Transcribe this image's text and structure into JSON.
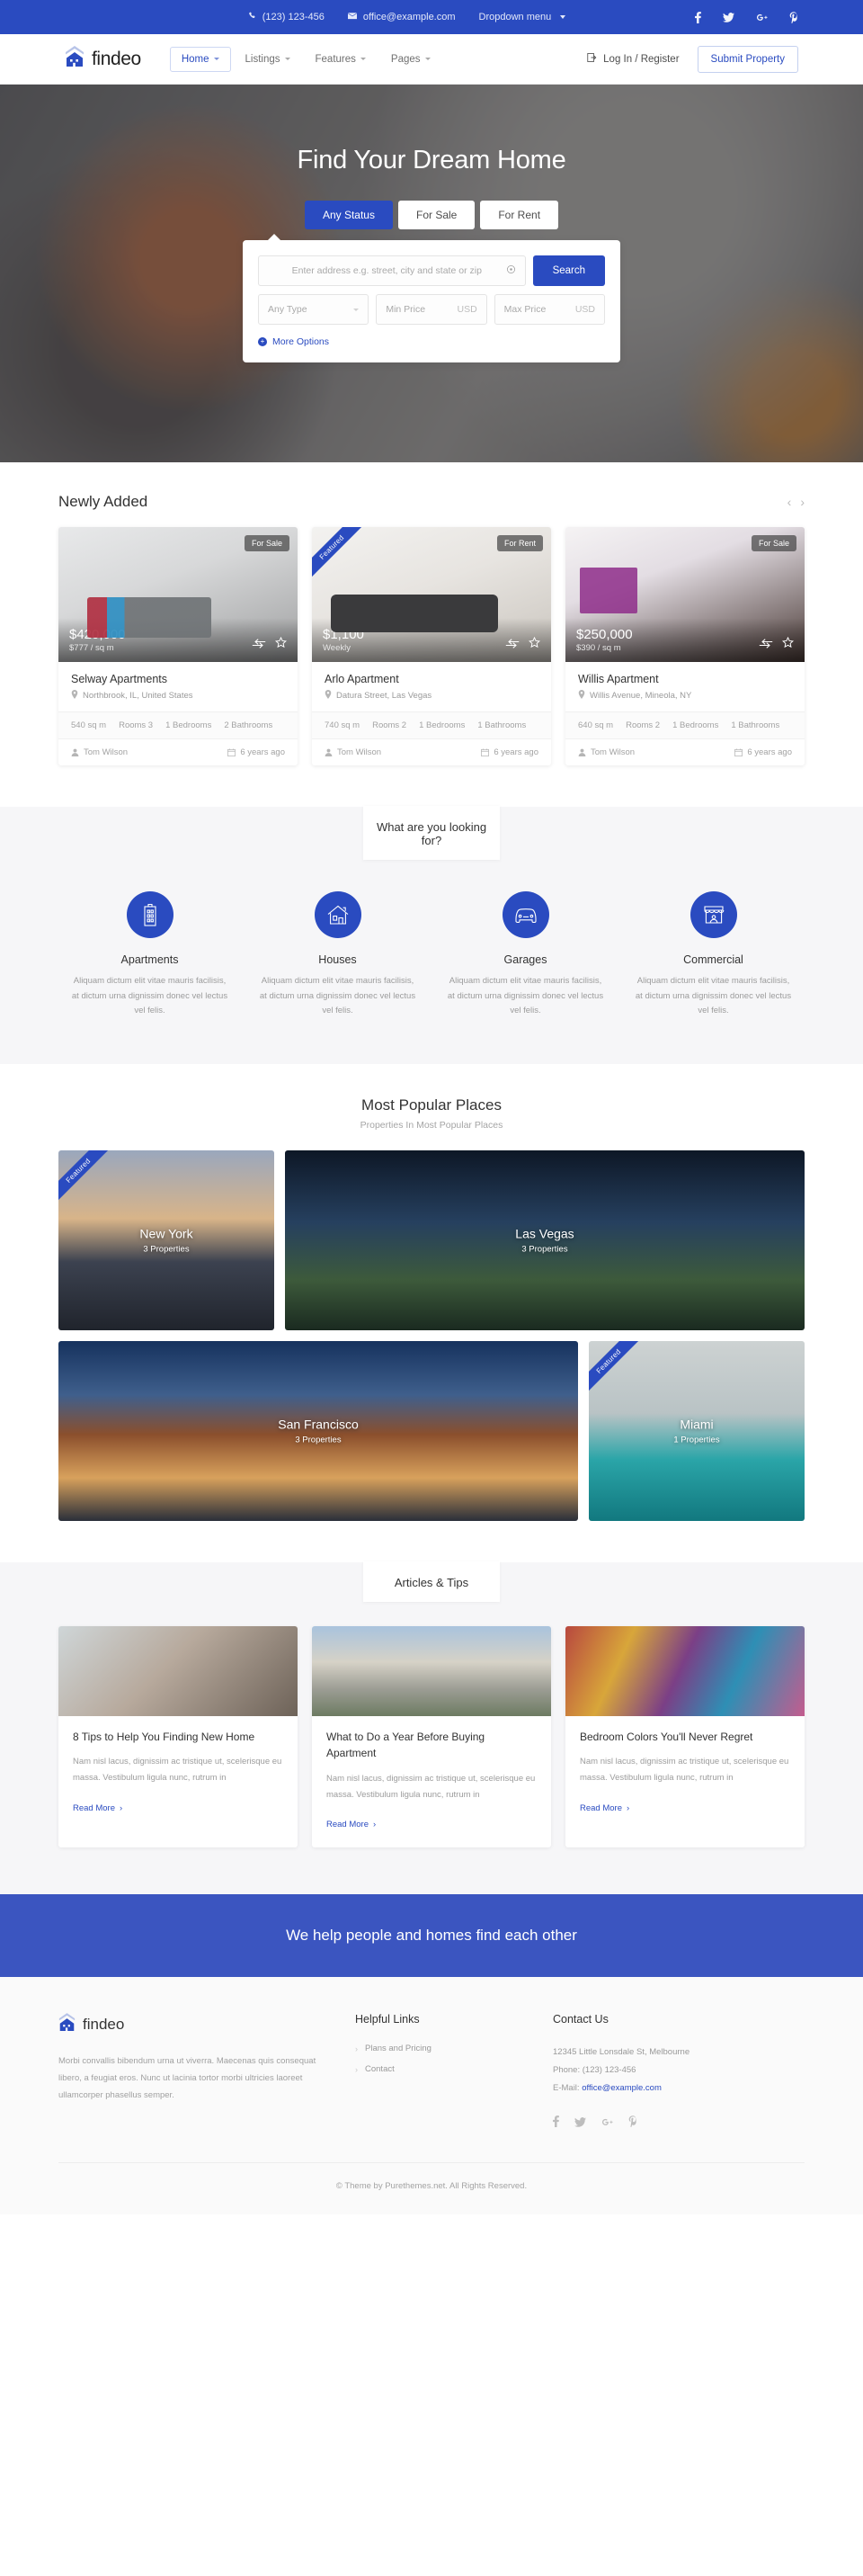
{
  "topbar": {
    "phone": "(123) 123-456",
    "email": "office@example.com",
    "dropdown_label": "Dropdown menu",
    "social": [
      "facebook-icon",
      "twitter-icon",
      "google-plus-icon",
      "pinterest-icon"
    ]
  },
  "header": {
    "logo_text": "findeo",
    "nav": [
      {
        "label": "Home",
        "active": true
      },
      {
        "label": "Listings",
        "active": false
      },
      {
        "label": "Features",
        "active": false
      },
      {
        "label": "Pages",
        "active": false
      }
    ],
    "login_label": "Log In / Register",
    "submit_label": "Submit Property"
  },
  "hero": {
    "title": "Find Your Dream Home",
    "tabs": [
      {
        "label": "Any Status",
        "active": true
      },
      {
        "label": "For Sale",
        "active": false
      },
      {
        "label": "For Rent",
        "active": false
      }
    ],
    "search": {
      "address_placeholder": "Enter address e.g. street, city and state or zip",
      "search_label": "Search",
      "type_value": "Any Type",
      "min_price_placeholder": "Min Price",
      "min_price_unit": "USD",
      "max_price_placeholder": "Max Price",
      "max_price_unit": "USD",
      "more_options_label": "More Options"
    }
  },
  "newly_added": {
    "title": "Newly Added",
    "properties": [
      {
        "status": "For Sale",
        "featured": false,
        "price": "$420,000",
        "price_sub": "$777 / sq m",
        "title": "Selway Apartments",
        "address": "Northbrook, IL, United States",
        "specs": [
          "540 sq m",
          "Rooms 3",
          "1 Bedrooms",
          "2 Bathrooms"
        ],
        "agent": "Tom Wilson",
        "date": "6 years ago"
      },
      {
        "status": "For Rent",
        "featured": true,
        "featured_label": "Featured",
        "price": "$1,100",
        "price_sub": "Weekly",
        "title": "Arlo Apartment",
        "address": "Datura Street, Las Vegas",
        "specs": [
          "740 sq m",
          "Rooms 2",
          "1 Bedrooms",
          "1 Bathrooms"
        ],
        "agent": "Tom Wilson",
        "date": "6 years ago"
      },
      {
        "status": "For Sale",
        "featured": false,
        "price": "$250,000",
        "price_sub": "$390 / sq m",
        "title": "Willis Apartment",
        "address": "Willis Avenue, Mineola, NY",
        "specs": [
          "640 sq m",
          "Rooms 2",
          "1 Bedrooms",
          "1 Bathrooms"
        ],
        "agent": "Tom Wilson",
        "date": "6 years ago"
      }
    ]
  },
  "looking_for": {
    "title": "What are you looking for?",
    "categories": [
      {
        "icon": "apartment-building-icon",
        "name": "Apartments",
        "desc": "Aliquam dictum elit vitae mauris facilisis, at dictum urna dignissim donec vel lectus vel felis."
      },
      {
        "icon": "house-icon",
        "name": "Houses",
        "desc": "Aliquam dictum elit vitae mauris facilisis, at dictum urna dignissim donec vel lectus vel felis."
      },
      {
        "icon": "car-icon",
        "name": "Garages",
        "desc": "Aliquam dictum elit vitae mauris facilisis, at dictum urna dignissim donec vel lectus vel felis."
      },
      {
        "icon": "storefront-icon",
        "name": "Commercial",
        "desc": "Aliquam dictum elit vitae mauris facilisis, at dictum urna dignissim donec vel lectus vel felis."
      }
    ]
  },
  "popular": {
    "title": "Most Popular Places",
    "subtitle": "Properties In Most Popular Places",
    "places": [
      {
        "name": "New York",
        "count": "3 Properties",
        "featured": true,
        "featured_label": "Featured"
      },
      {
        "name": "Las Vegas",
        "count": "3 Properties",
        "featured": false
      },
      {
        "name": "San Francisco",
        "count": "3 Properties",
        "featured": false
      },
      {
        "name": "Miami",
        "count": "1 Properties",
        "featured": true,
        "featured_label": "Featured"
      }
    ]
  },
  "articles": {
    "title": "Articles & Tips",
    "items": [
      {
        "title": "8 Tips to Help You Finding New Home",
        "desc": "Nam nisl lacus, dignissim ac tristique ut, scelerisque eu massa. Vestibulum ligula nunc, rutrum in",
        "more_label": "Read More"
      },
      {
        "title": "What to Do a Year Before Buying Apartment",
        "desc": "Nam nisl lacus, dignissim ac tristique ut, scelerisque eu massa. Vestibulum ligula nunc, rutrum in",
        "more_label": "Read More"
      },
      {
        "title": "Bedroom Colors You'll Never Regret",
        "desc": "Nam nisl lacus, dignissim ac tristique ut, scelerisque eu massa. Vestibulum ligula nunc, rutrum in",
        "more_label": "Read More"
      }
    ]
  },
  "cta": {
    "text": "We help people and homes find each other"
  },
  "footer": {
    "logo_text": "findeo",
    "description": "Morbi convallis bibendum urna ut viverra. Maecenas quis consequat libero, a feugiat eros. Nunc ut lacinia tortor morbi ultricies laoreet ullamcorper phasellus semper.",
    "helpful_links_head": "Helpful Links",
    "helpful_links": [
      "Plans and Pricing",
      "Contact"
    ],
    "contact_head": "Contact Us",
    "address": "12345 Little Lonsdale St, Melbourne",
    "phone_line": "Phone: (123) 123-456",
    "email_label": "E-Mail:",
    "email": "office@example.com",
    "social": [
      "facebook-icon",
      "twitter-icon",
      "google-plus-icon",
      "pinterest-icon"
    ],
    "copyright": "© Theme by Purethemes.net. All Rights Reserved."
  },
  "colors": {
    "brand": "#2a4bc0",
    "cta_bg": "#3b55c0",
    "text": "#333333",
    "muted": "#9c9c9c"
  }
}
